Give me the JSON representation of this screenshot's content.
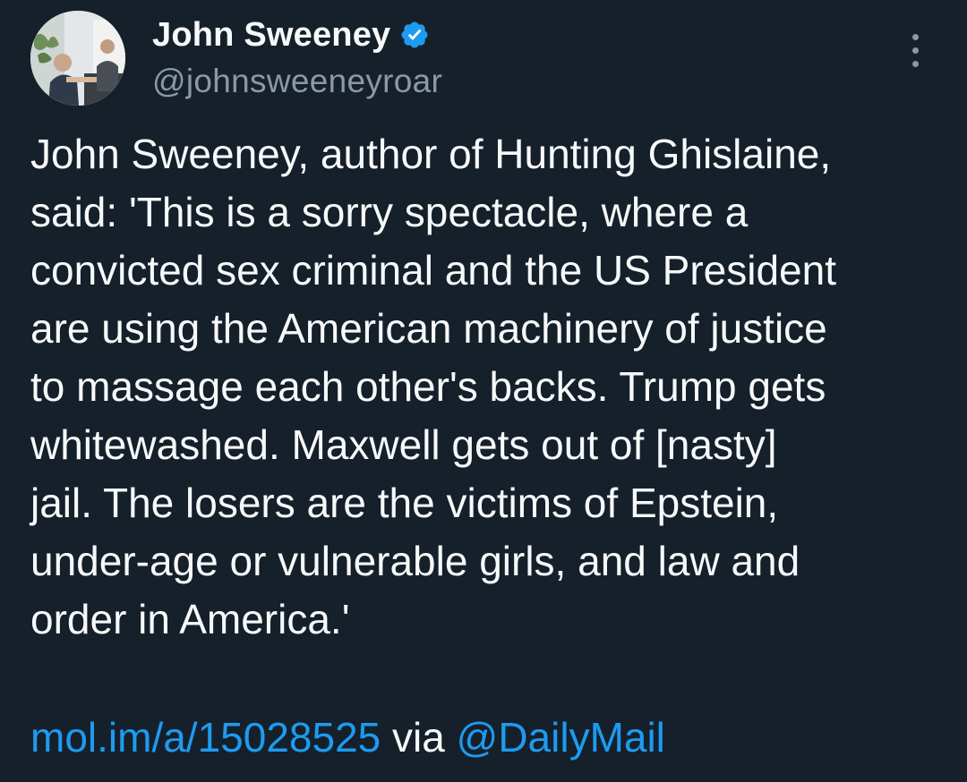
{
  "author": {
    "display_name": "John Sweeney",
    "handle": "@johnsweeneyroar",
    "verified_icon": "verified-badge-icon",
    "avatar_icon": "profile-photo"
  },
  "menu": {
    "icon": "more-vertical-icon"
  },
  "tweet": {
    "text": "John Sweeney, author of Hunting Ghislaine,\nsaid: 'This is a sorry spectacle, where a\nconvicted sex criminal and the US President\nare using the American machinery of justice\nto massage each other's backs. Trump gets\nwhitewashed. Maxwell gets out of [nasty]\njail. The losers are the victims of Epstein,\nunder-age or vulnerable girls, and law and\norder in America.'",
    "link_text": "mol.im/a/15028525",
    "via_text": " via ",
    "mention_text": "@DailyMail"
  },
  "colors": {
    "background": "#15202b",
    "text": "#f7f9f9",
    "secondary": "#8b98a5",
    "accent": "#1d9bf0"
  }
}
